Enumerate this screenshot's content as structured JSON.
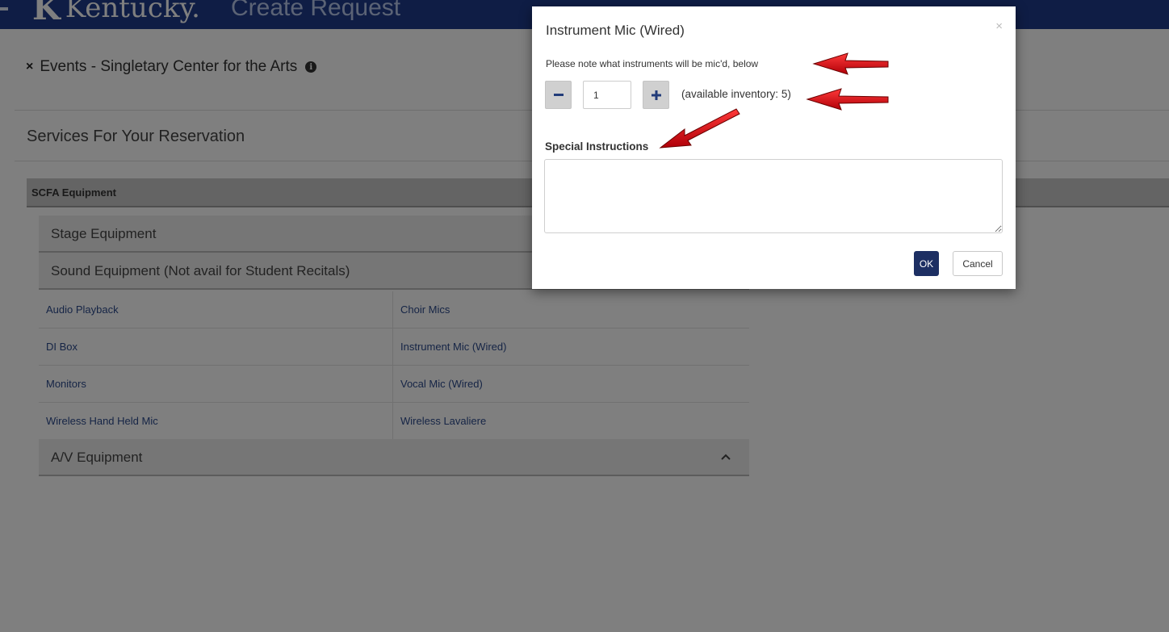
{
  "header": {
    "logo_text": "Kentucky.",
    "logo_mark": "K",
    "app_title": "Create Request"
  },
  "reservation": {
    "close_icon": "×",
    "title": "Events - Singletary Center for the Arts",
    "info_icon": "i",
    "services_heading": "Services For Your Reservation"
  },
  "equipment": {
    "category": "SCFA Equipment",
    "sections": [
      {
        "label": "Stage Equipment"
      },
      {
        "label": "Sound Equipment (Not avail for Student Recitals)"
      },
      {
        "label": "A/V Equipment",
        "chevron": "^"
      }
    ],
    "sound_items": [
      [
        "Audio Playback",
        "Choir Mics"
      ],
      [
        "DI Box",
        "Instrument Mic (Wired)"
      ],
      [
        "Monitors",
        "Vocal Mic (Wired)"
      ],
      [
        "Wireless Hand Held Mic",
        "Wireless Lavaliere"
      ]
    ]
  },
  "modal": {
    "title": "Instrument Mic (Wired)",
    "close_icon": "×",
    "note": "Please note what instruments will be mic'd, below",
    "minus_label": "−",
    "plus_label": "+",
    "quantity": "1",
    "inventory_text": "(available inventory: 5)",
    "special_label": "Special Instructions",
    "special_value": "",
    "ok_label": "OK",
    "cancel_label": "Cancel"
  },
  "colors": {
    "brand_blue": "#1e3a8a",
    "ok_button": "#1d2f63",
    "arrow_red": "#e0141c"
  }
}
